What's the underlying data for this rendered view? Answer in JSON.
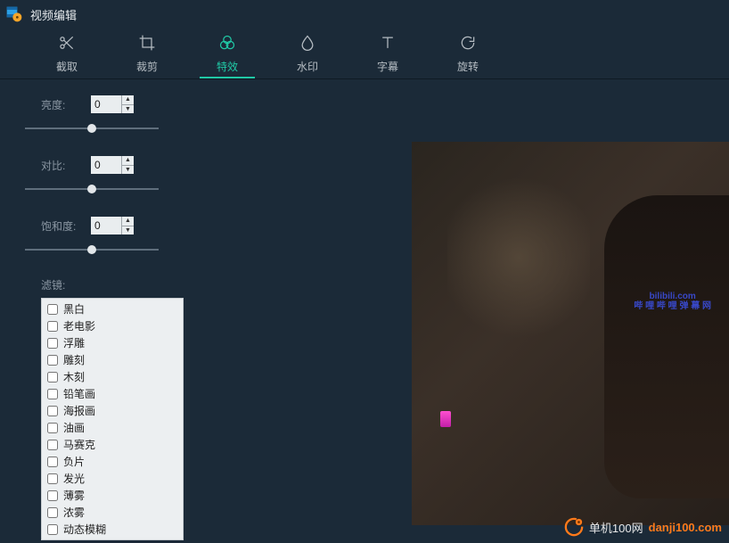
{
  "app": {
    "title": "视频编辑"
  },
  "tabs": [
    {
      "id": "clip",
      "label": "截取",
      "icon": "✂"
    },
    {
      "id": "crop",
      "label": "裁剪",
      "icon": "◻"
    },
    {
      "id": "effect",
      "label": "特效",
      "icon": "❀"
    },
    {
      "id": "water",
      "label": "水印",
      "icon": "◇"
    },
    {
      "id": "sub",
      "label": "字幕",
      "icon": "T"
    },
    {
      "id": "rotate",
      "label": "旋转",
      "icon": "↻"
    }
  ],
  "active_tab": "effect",
  "controls": {
    "brightness": {
      "label": "亮度:",
      "value": "0"
    },
    "contrast": {
      "label": "对比:",
      "value": "0"
    },
    "saturation": {
      "label": "饱和度:",
      "value": "0"
    }
  },
  "filter_label": "滤镜:",
  "filters": [
    "黑白",
    "老电影",
    "浮雕",
    "雕刻",
    "木刻",
    "铅笔画",
    "海报画",
    "油画",
    "马赛克",
    "负片",
    "发光",
    "薄雾",
    "浓雾",
    "动态模糊"
  ],
  "overlay": {
    "line1": "bilibili.com",
    "line2": "哔 哩 哔 哩 弹 幕 网"
  },
  "footer": {
    "text1": "单机100网",
    "text2": "danji100.com"
  }
}
